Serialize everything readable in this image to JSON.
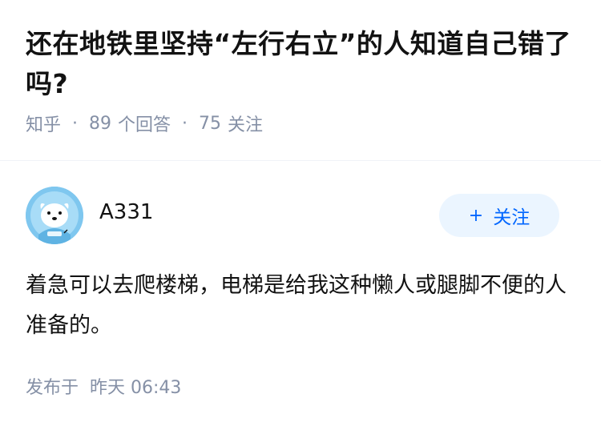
{
  "question": {
    "title": "还在地铁里坚持“左行右立”的人知道自己错了吗?",
    "source": "知乎",
    "answer_count": "89",
    "answer_label": "个回答",
    "follow_count": "75",
    "follow_label": "关注",
    "separator": "·"
  },
  "answer": {
    "author_name": "A331",
    "follow_button": "关注",
    "follow_icon": "+",
    "content": "着急可以去爬楼梯，电梯是给我这种懒人或腿脚不便的人准备的。",
    "time_prefix": "发布于",
    "time_value": "昨天 06:43"
  },
  "colors": {
    "accent": "#0066ff",
    "meta_gray": "#8590a6",
    "button_bg": "#ebf5ff",
    "avatar_bg": "#7fc7ef"
  }
}
